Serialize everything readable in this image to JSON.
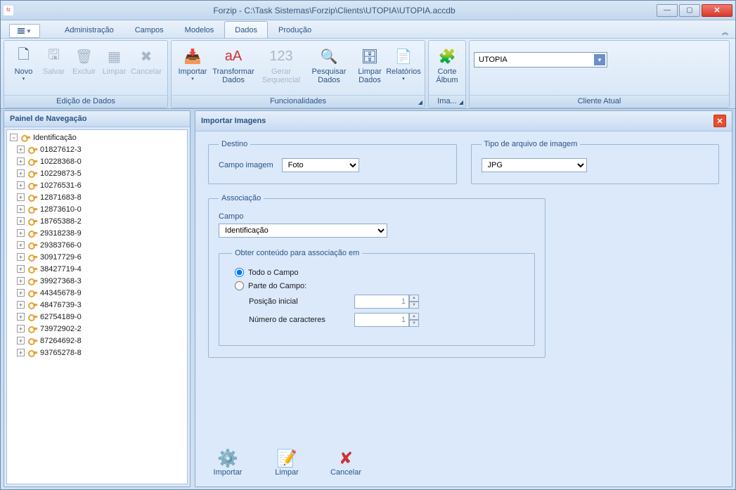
{
  "window": {
    "title": "Forzip - C:\\Task Sistemas\\Forzip\\Clients\\UTOPIA\\UTOPIA.accdb"
  },
  "menubar": {
    "items": [
      "Administração",
      "Campos",
      "Modelos",
      "Dados",
      "Produção"
    ],
    "active_index": 3
  },
  "ribbon": {
    "groups": {
      "edicao": {
        "title": "Edição de Dados",
        "buttons": {
          "novo": "Novo",
          "salvar": "Salvar",
          "excluir": "Excluir",
          "limpar": "Limpar",
          "cancelar": "Cancelar"
        }
      },
      "func": {
        "title": "Funcionalidades",
        "buttons": {
          "importar": "Importar",
          "transformar": "Transformar Dados",
          "gerar": "Gerar Sequencial",
          "pesquisar": "Pesquisar Dados",
          "limpar": "Limpar Dados",
          "relatorios": "Relatórios"
        }
      },
      "ima": {
        "title": "Ima...",
        "buttons": {
          "corte": "Corte Álbum"
        }
      },
      "cliente": {
        "title": "Cliente Atual",
        "value": "UTOPIA"
      }
    }
  },
  "nav": {
    "title": "Painel de Navegação",
    "root": "Identificação",
    "items": [
      "01827612-3",
      "10228368-0",
      "10229873-5",
      "10276531-6",
      "12871683-8",
      "12873610-0",
      "18765388-2",
      "29318238-9",
      "29383766-0",
      "30917729-6",
      "38427719-4",
      "39927368-3",
      "44345678-9",
      "48476739-3",
      "62754189-0",
      "73972902-2",
      "87264692-8",
      "93765278-8"
    ]
  },
  "panel": {
    "title": "Importar Imagens",
    "destino": {
      "legend": "Destino",
      "label": "Campo imagem",
      "value": "Foto"
    },
    "tipo": {
      "legend": "Tipo de arquivo de imagem",
      "value": "JPG"
    },
    "assoc": {
      "legend": "Associação",
      "campo_label": "Campo",
      "campo_value": "Identificação",
      "obter_legend": "Obter conteúdo para associação em",
      "opt_todo": "Todo o Campo",
      "opt_parte": "Parte do Campo:",
      "pos_label": "Posição inicial",
      "pos_value": "1",
      "num_label": "Número de caracteres",
      "num_value": "1"
    },
    "actions": {
      "importar": "Importar",
      "limpar": "Limpar",
      "cancelar": "Cancelar"
    }
  }
}
